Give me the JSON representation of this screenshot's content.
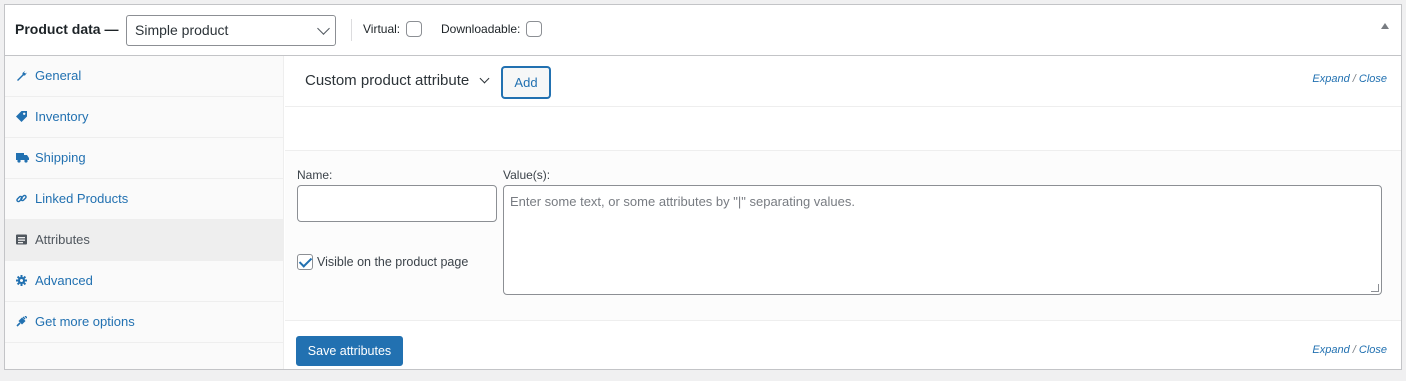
{
  "header": {
    "title": "Product data —",
    "product_type": "Simple product",
    "virtual_label": "Virtual:",
    "downloadable_label": "Downloadable:"
  },
  "sidebar": {
    "items": [
      {
        "label": "General",
        "icon": "wrench-icon"
      },
      {
        "label": "Inventory",
        "icon": "tag-icon"
      },
      {
        "label": "Shipping",
        "icon": "truck-icon"
      },
      {
        "label": "Linked Products",
        "icon": "link-icon"
      },
      {
        "label": "Attributes",
        "icon": "list-icon",
        "active": true
      },
      {
        "label": "Advanced",
        "icon": "gear-icon"
      },
      {
        "label": "Get more options",
        "icon": "plug-icon"
      }
    ]
  },
  "attributes": {
    "select_label": "Custom product attribute",
    "add_label": "Add",
    "expand_label": "Expand",
    "slash": "/",
    "close_label": "Close",
    "name_label": "Name:",
    "values_label": "Value(s):",
    "values_placeholder": "Enter some text, or some attributes by \"|\" separating values.",
    "visible_label": "Visible on the product page",
    "visible_checked": true,
    "save_label": "Save attributes"
  },
  "colors": {
    "accent": "#2271b1",
    "border": "#c3c4c7",
    "sidebar_bg": "#fafafa",
    "active_tab_bg": "#eeeeee"
  }
}
